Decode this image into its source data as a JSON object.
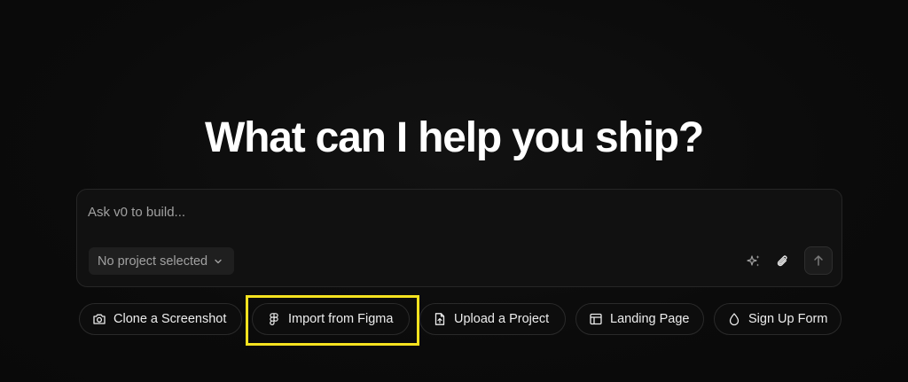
{
  "hero": {
    "title": "What can I help you ship?"
  },
  "prompt": {
    "placeholder": "Ask v0 to build...",
    "value": "",
    "project_select_label": "No project selected"
  },
  "toolbar_icons": {
    "enhance": "sparkles-icon",
    "attach": "paperclip-icon",
    "send": "arrow-up-icon"
  },
  "suggestions": [
    {
      "label": "Clone a Screenshot",
      "icon": "camera-icon"
    },
    {
      "label": "Import from Figma",
      "icon": "figma-icon"
    },
    {
      "label": "Upload a Project",
      "icon": "file-upload-icon"
    },
    {
      "label": "Landing Page",
      "icon": "layout-icon"
    },
    {
      "label": "Sign Up Form",
      "icon": "droplet-icon"
    }
  ],
  "colors": {
    "background": "#0a0a0a",
    "highlight": "#f5e21f"
  }
}
